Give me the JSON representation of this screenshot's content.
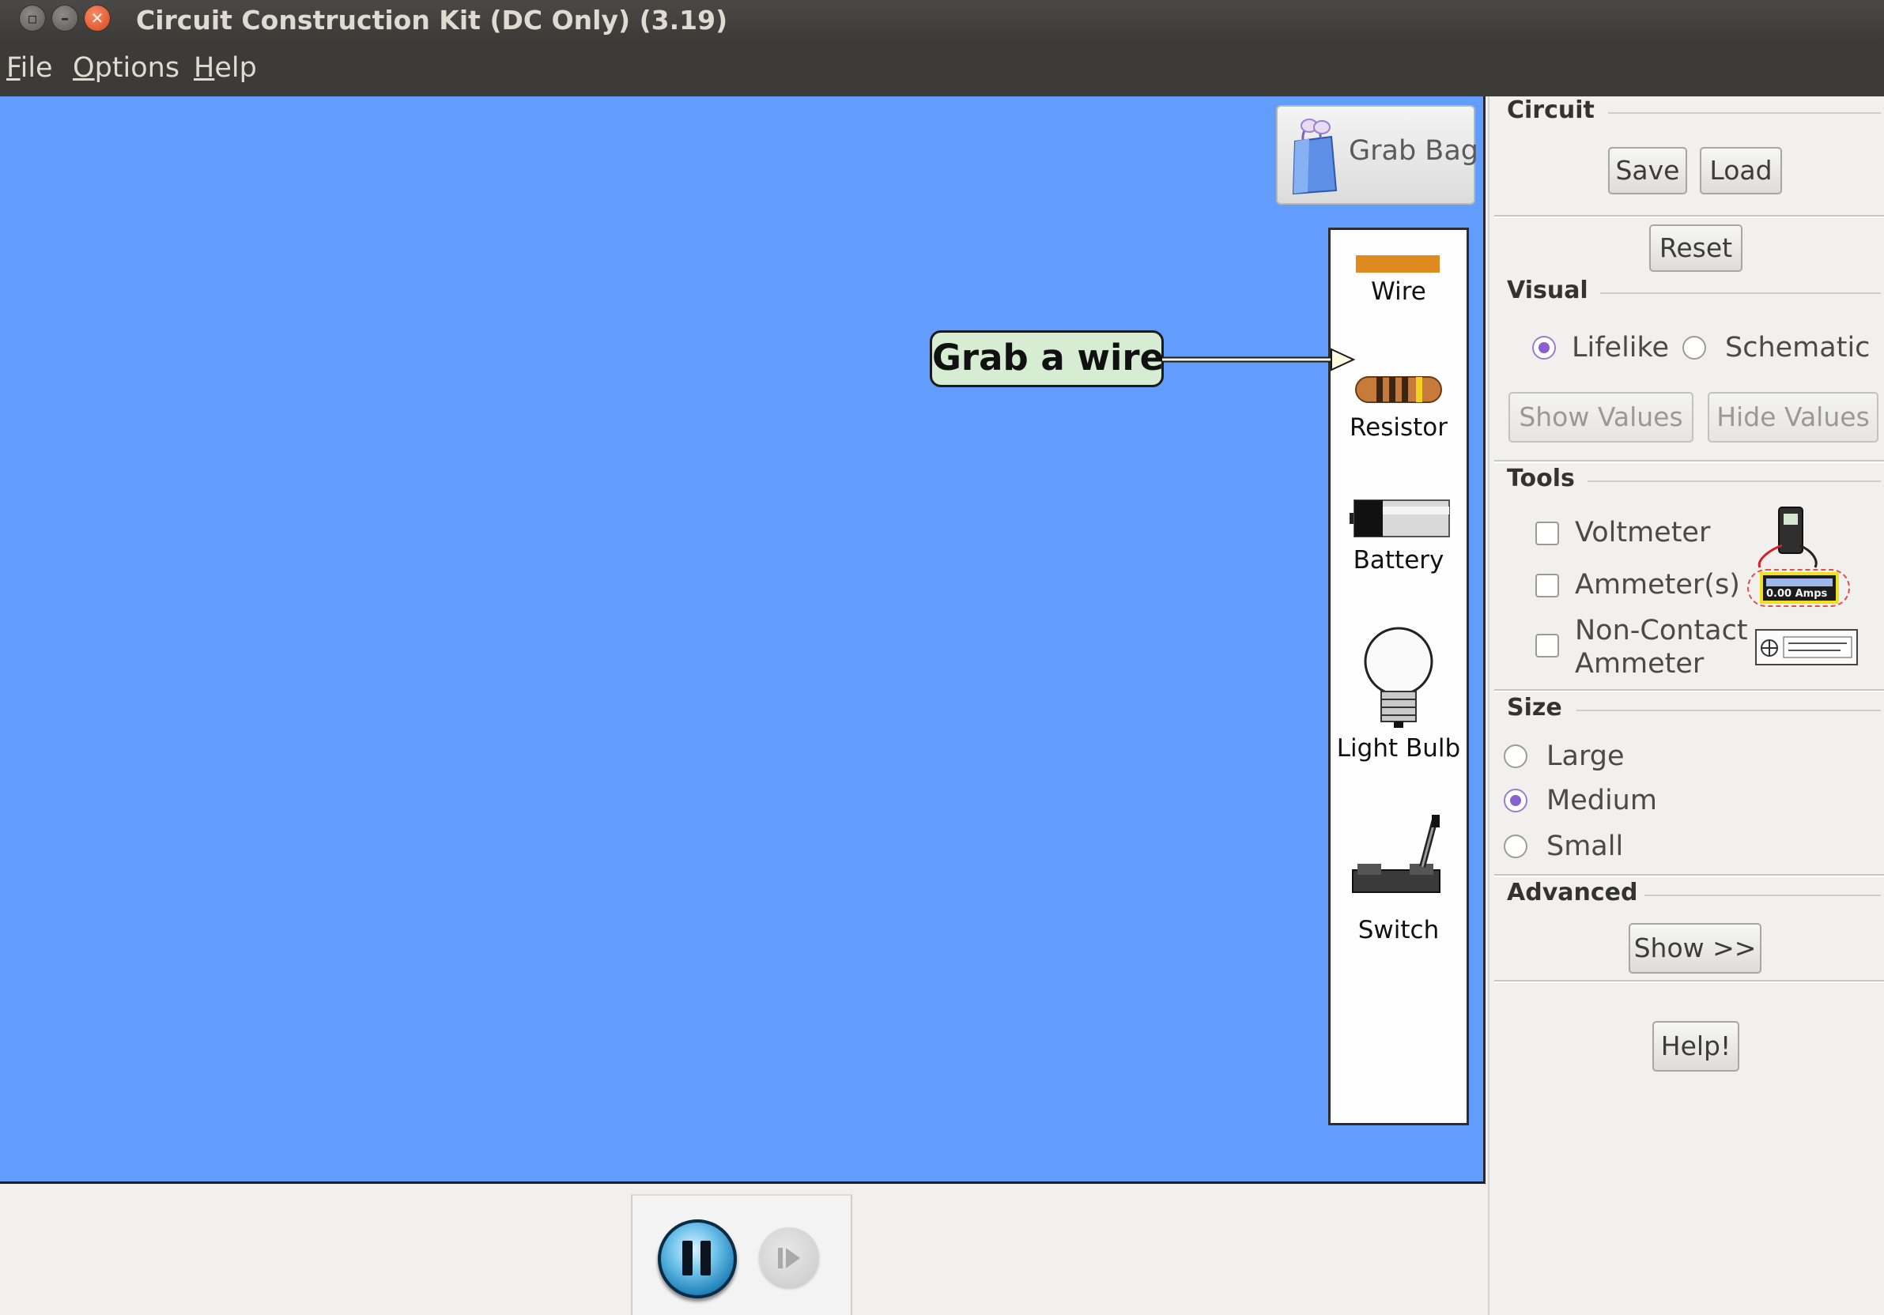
{
  "window": {
    "title": "Circuit Construction Kit (DC Only) (3.19)"
  },
  "menu": {
    "items": [
      {
        "first": "F",
        "rest": "ile"
      },
      {
        "first": "O",
        "rest": "ptions"
      },
      {
        "first": "H",
        "rest": "elp"
      }
    ]
  },
  "canvas": {
    "background_color": "#629dfd",
    "grab_bag_label": "Grab Bag",
    "tooltip": "Grab a wire"
  },
  "toolbox": {
    "items": [
      {
        "label": "Wire",
        "icon": "wire-icon"
      },
      {
        "label": "Resistor",
        "icon": "resistor-icon"
      },
      {
        "label": "Battery",
        "icon": "battery-icon"
      },
      {
        "label": "Light Bulb",
        "icon": "light-bulb-icon"
      },
      {
        "label": "Switch",
        "icon": "switch-icon"
      }
    ]
  },
  "panel": {
    "circuit": {
      "title": "Circuit",
      "save": "Save",
      "load": "Load",
      "reset": "Reset"
    },
    "visual": {
      "title": "Visual",
      "options": [
        "Lifelike",
        "Schematic"
      ],
      "selected": "Lifelike",
      "show_values": "Show Values",
      "hide_values": "Hide Values"
    },
    "tools": {
      "title": "Tools",
      "voltmeter": "Voltmeter",
      "ammeters": "Ammeter(s)",
      "noncontact_line1": "Non-Contact",
      "noncontact_line2": "Ammeter",
      "ammeter_readout": "0.00 Amps"
    },
    "size": {
      "title": "Size",
      "options": [
        "Large",
        "Medium",
        "Small"
      ],
      "selected": "Medium"
    },
    "advanced": {
      "title": "Advanced",
      "show": "Show >>"
    },
    "help": "Help!"
  },
  "colors": {
    "canvas": "#629dfd",
    "tooltip_bg": "#d6ecd3",
    "wire": "#df8a1f",
    "radio_selected": "#8a5fcf"
  }
}
